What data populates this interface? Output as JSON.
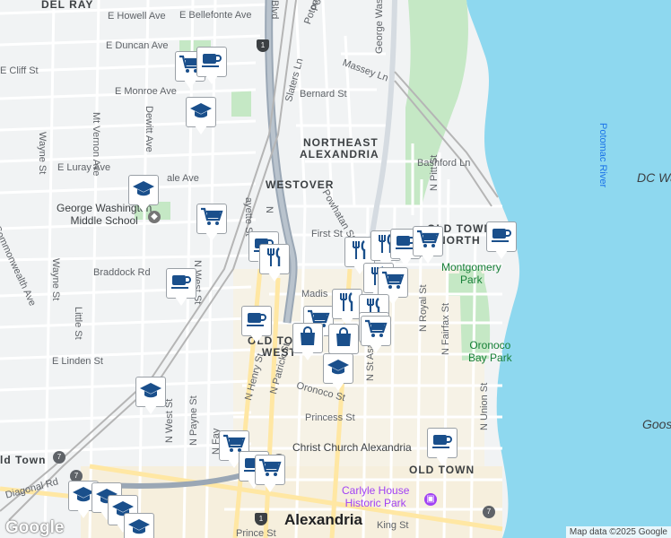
{
  "street_labels": [
    {
      "text": "E Howell Ave"
    },
    {
      "text": "E Bellefonte Ave"
    },
    {
      "text": "E Duncan Ave"
    },
    {
      "text": "E Cliff St"
    },
    {
      "text": "E Monroe Ave"
    },
    {
      "text": "E Luray Ave"
    },
    {
      "text": "ale Ave"
    },
    {
      "text": "Mt Vernon Ave"
    },
    {
      "text": "Dewitt Ave"
    },
    {
      "text": "Wayne St"
    },
    {
      "text": "Wayne St"
    },
    {
      "text": "Commonwealth Ave"
    },
    {
      "text": "Little St"
    },
    {
      "text": "N West St"
    },
    {
      "text": "E Linden St"
    },
    {
      "text": "Braddock Rd"
    },
    {
      "text": "Potomac Ave"
    },
    {
      "text": "Potomac Gr"
    },
    {
      "text": "Massey Ln"
    },
    {
      "text": "Bernard St"
    },
    {
      "text": "Slaters Ln"
    },
    {
      "text": "George Washington"
    },
    {
      "text": "Bashford Ln"
    },
    {
      "text": "Powhatan St"
    },
    {
      "text": "First St"
    },
    {
      "text": "Madis"
    },
    {
      "text": "N Pitt St"
    },
    {
      "text": "N Royal St"
    },
    {
      "text": "N Fairfax St"
    },
    {
      "text": "N Union St"
    },
    {
      "text": "N St Asaph St"
    },
    {
      "text": "N Henry St"
    },
    {
      "text": "N Patrick St"
    },
    {
      "text": "Oronoco St"
    },
    {
      "text": "Princess St"
    },
    {
      "text": "N Payne St"
    },
    {
      "text": "N West St"
    },
    {
      "text": "N Fay"
    },
    {
      "text": "Diagonal Rd"
    },
    {
      "text": "King St"
    },
    {
      "text": "Prince St"
    },
    {
      "text": "Blvd"
    },
    {
      "text": "ayette St"
    },
    {
      "text": "N"
    },
    {
      "text": "N"
    }
  ],
  "area_labels": [
    {
      "text": "DEL RAY"
    },
    {
      "text": "NORTHEAST"
    },
    {
      "text": "ALEXANDRIA"
    },
    {
      "text": "WESTOVER"
    },
    {
      "text": "OLD TOWN"
    },
    {
      "text": "NORTH"
    },
    {
      "text": "OLD TO"
    },
    {
      "text": "WEST"
    },
    {
      "text": "OLD TOWN"
    },
    {
      "text": "Alexandria"
    },
    {
      "text": "ld Town"
    }
  ],
  "park_labels": [
    {
      "text": "Montgomery\nPark"
    },
    {
      "text": "Oronoco\nBay Park"
    }
  ],
  "water_labels": [
    {
      "text": "Potomac River"
    },
    {
      "text": "DC Wa"
    },
    {
      "text": "Goos"
    }
  ],
  "poi_labels": [
    {
      "text": "George Washington\nMiddle School",
      "kind": "school"
    },
    {
      "text": "Christ Church Alexandria",
      "kind": "church"
    },
    {
      "text": "Carlyle House\nHistoric Park",
      "kind": "history"
    }
  ],
  "route_shields": [
    {
      "text": "1"
    },
    {
      "text": "7"
    },
    {
      "text": "7"
    },
    {
      "text": "1"
    },
    {
      "text": "7"
    }
  ],
  "markers": [
    {
      "kind": "shopping"
    },
    {
      "kind": "coffee"
    },
    {
      "kind": "school"
    },
    {
      "kind": "school"
    },
    {
      "kind": "shopping"
    },
    {
      "kind": "coffee"
    },
    {
      "kind": "restaurant"
    },
    {
      "kind": "coffee"
    },
    {
      "kind": "coffee"
    },
    {
      "kind": "school"
    },
    {
      "kind": "restaurant"
    },
    {
      "kind": "restaurant"
    },
    {
      "kind": "coffee"
    },
    {
      "kind": "shopping"
    },
    {
      "kind": "coffee"
    },
    {
      "kind": "restaurant"
    },
    {
      "kind": "shopping"
    },
    {
      "kind": "shopping"
    },
    {
      "kind": "restaurant"
    },
    {
      "kind": "restaurant"
    },
    {
      "kind": "shopping"
    },
    {
      "kind": "shopping"
    },
    {
      "kind": "bag"
    },
    {
      "kind": "bag"
    },
    {
      "kind": "school"
    },
    {
      "kind": "shopping"
    },
    {
      "kind": "coffee"
    },
    {
      "kind": "shopping"
    },
    {
      "kind": "coffee"
    },
    {
      "kind": "school"
    },
    {
      "kind": "school"
    },
    {
      "kind": "school"
    },
    {
      "kind": "school"
    }
  ],
  "attribution": "Map data ©2025 Google",
  "logo": "Google",
  "colors": {
    "water": "#8ed8ef",
    "park": "#c5e8c5",
    "road": "#ffffff",
    "highway": "#9aa7b5",
    "rail": "#b5b5b5",
    "icon": "#1a4f8b"
  }
}
